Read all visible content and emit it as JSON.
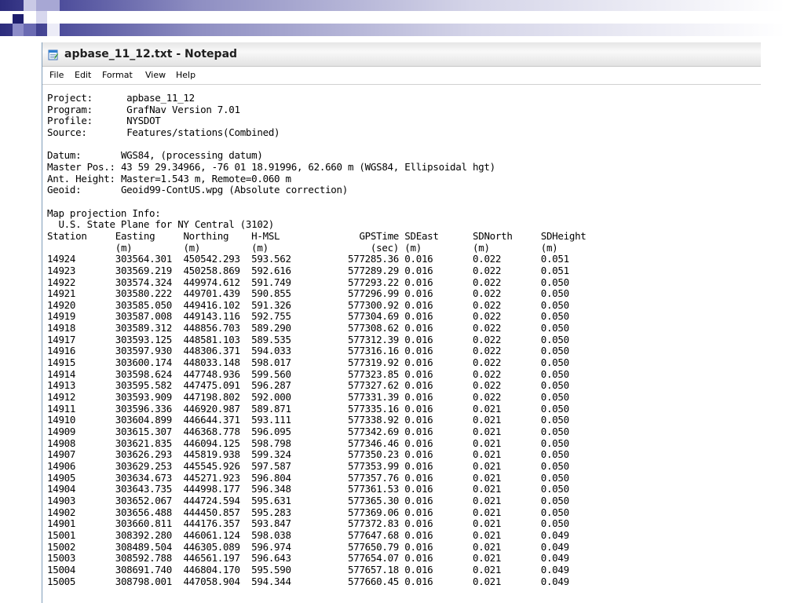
{
  "window": {
    "title": "apbase_11_12.txt - Notepad",
    "icon": "notepad-icon"
  },
  "menu": {
    "file": "File",
    "edit": "Edit",
    "format": "Format",
    "view": "View",
    "help": "Help"
  },
  "colors": {
    "slide_accent": "#2c2c7c",
    "title_bar": "#ececec",
    "window_border": "#7f9db9"
  },
  "document": {
    "header": {
      "project_key": "Project:",
      "project": "apbase_11_12",
      "program_key": "Program:",
      "program": "GrafNav Version 7.01",
      "profile_key": "Profile:",
      "profile": "NYSDOT",
      "source_key": "Source:",
      "source": "Features/stations(Combined)",
      "datum_key": "Datum:",
      "datum": "WGS84, (processing datum)",
      "master_pos_key": "Master Pos.:",
      "master_pos": "43 59 29.34966, -76 01 18.91996, 62.660 m (WGS84, Ellipsoidal hgt)",
      "ant_height_key": "Ant. Height:",
      "ant_height": "Master=1.543 m, Remote=0.060 m",
      "geoid_key": "Geoid:",
      "geoid": "Geoid99-ContUS.wpg (Absolute correction)",
      "map_projection_title": "Map projection Info:",
      "map_projection": "U.S. State Plane for NY Central (3102)"
    },
    "table": {
      "columns": [
        "Station",
        "Easting",
        "Northing",
        "H-MSL",
        "GPSTime",
        "SDEast",
        "SDNorth",
        "SDHeight"
      ],
      "units": [
        "",
        "(m)",
        "(m)",
        "(m)",
        "(sec)",
        "(m)",
        "(m)",
        "(m)"
      ],
      "rows": [
        [
          "14924",
          "303564.301",
          "450542.293",
          "593.562",
          "577285.36",
          "0.016",
          "0.022",
          "0.051"
        ],
        [
          "14923",
          "303569.219",
          "450258.869",
          "592.616",
          "577289.29",
          "0.016",
          "0.022",
          "0.051"
        ],
        [
          "14922",
          "303574.324",
          "449974.612",
          "591.749",
          "577293.22",
          "0.016",
          "0.022",
          "0.050"
        ],
        [
          "14921",
          "303580.222",
          "449701.439",
          "590.855",
          "577296.99",
          "0.016",
          "0.022",
          "0.050"
        ],
        [
          "14920",
          "303585.050",
          "449416.102",
          "591.326",
          "577300.92",
          "0.016",
          "0.022",
          "0.050"
        ],
        [
          "14919",
          "303587.008",
          "449143.116",
          "592.755",
          "577304.69",
          "0.016",
          "0.022",
          "0.050"
        ],
        [
          "14918",
          "303589.312",
          "448856.703",
          "589.290",
          "577308.62",
          "0.016",
          "0.022",
          "0.050"
        ],
        [
          "14917",
          "303593.125",
          "448581.103",
          "589.535",
          "577312.39",
          "0.016",
          "0.022",
          "0.050"
        ],
        [
          "14916",
          "303597.930",
          "448306.371",
          "594.033",
          "577316.16",
          "0.016",
          "0.022",
          "0.050"
        ],
        [
          "14915",
          "303600.174",
          "448033.148",
          "598.017",
          "577319.92",
          "0.016",
          "0.022",
          "0.050"
        ],
        [
          "14914",
          "303598.624",
          "447748.936",
          "599.560",
          "577323.85",
          "0.016",
          "0.022",
          "0.050"
        ],
        [
          "14913",
          "303595.582",
          "447475.091",
          "596.287",
          "577327.62",
          "0.016",
          "0.022",
          "0.050"
        ],
        [
          "14912",
          "303593.909",
          "447198.802",
          "592.000",
          "577331.39",
          "0.016",
          "0.022",
          "0.050"
        ],
        [
          "14911",
          "303596.336",
          "446920.987",
          "589.871",
          "577335.16",
          "0.016",
          "0.021",
          "0.050"
        ],
        [
          "14910",
          "303604.899",
          "446644.371",
          "593.111",
          "577338.92",
          "0.016",
          "0.021",
          "0.050"
        ],
        [
          "14909",
          "303615.307",
          "446368.778",
          "596.095",
          "577342.69",
          "0.016",
          "0.021",
          "0.050"
        ],
        [
          "14908",
          "303621.835",
          "446094.125",
          "598.798",
          "577346.46",
          "0.016",
          "0.021",
          "0.050"
        ],
        [
          "14907",
          "303626.293",
          "445819.938",
          "599.324",
          "577350.23",
          "0.016",
          "0.021",
          "0.050"
        ],
        [
          "14906",
          "303629.253",
          "445545.926",
          "597.587",
          "577353.99",
          "0.016",
          "0.021",
          "0.050"
        ],
        [
          "14905",
          "303634.673",
          "445271.923",
          "596.804",
          "577357.76",
          "0.016",
          "0.021",
          "0.050"
        ],
        [
          "14904",
          "303643.735",
          "444998.177",
          "596.348",
          "577361.53",
          "0.016",
          "0.021",
          "0.050"
        ],
        [
          "14903",
          "303652.067",
          "444724.594",
          "595.631",
          "577365.30",
          "0.016",
          "0.021",
          "0.050"
        ],
        [
          "14902",
          "303656.488",
          "444450.857",
          "595.283",
          "577369.06",
          "0.016",
          "0.021",
          "0.050"
        ],
        [
          "14901",
          "303660.811",
          "444176.357",
          "593.847",
          "577372.83",
          "0.016",
          "0.021",
          "0.050"
        ],
        [
          "15001",
          "308392.280",
          "446061.124",
          "598.038",
          "577647.68",
          "0.016",
          "0.021",
          "0.049"
        ],
        [
          "15002",
          "308489.504",
          "446305.089",
          "596.974",
          "577650.79",
          "0.016",
          "0.021",
          "0.049"
        ],
        [
          "15003",
          "308592.788",
          "446561.197",
          "596.643",
          "577654.07",
          "0.016",
          "0.021",
          "0.049"
        ],
        [
          "15004",
          "308691.740",
          "446804.170",
          "595.590",
          "577657.18",
          "0.016",
          "0.021",
          "0.049"
        ],
        [
          "15005",
          "308798.001",
          "447058.904",
          "594.344",
          "577660.45",
          "0.016",
          "0.021",
          "0.049"
        ]
      ]
    }
  }
}
